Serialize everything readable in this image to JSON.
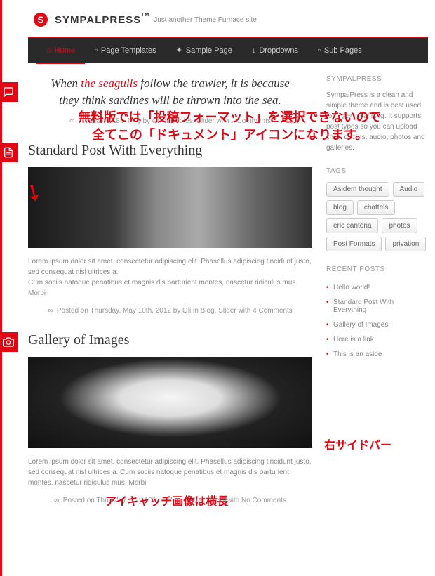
{
  "header": {
    "logo_letter": "S",
    "site_name": "SYMPALPRESS",
    "tm": "TM",
    "tagline": "Just another Theme Furnace site"
  },
  "nav": [
    {
      "label": "Home",
      "icon": "home",
      "active": true
    },
    {
      "label": "Page Templates",
      "icon": "page"
    },
    {
      "label": "Sample Page",
      "icon": "plus"
    },
    {
      "label": "Dropdowns",
      "icon": "down"
    },
    {
      "label": "Sub Pages",
      "icon": "page"
    }
  ],
  "posts": {
    "quote": {
      "text_pre": "When ",
      "text_hl": "the seagulls",
      "text_post": " follow the trawler, it is because they think sardines will be thrown into the sea.",
      "meta": "Posted on 18th May by Oli in Quotes, Slider with 2 Comments"
    },
    "standard": {
      "title": "Standard Post With Everything",
      "excerpt": "Lorem ipsum dolor sit amet, consectetur adipiscing elit. Phasellus adipiscing tincidunt justo, sed consequat nisl ultrices a.\nCum sociis natoque penatibus et magnis dis parturient montes, nascetur ridiculus mus. Morbi",
      "meta": "Posted on Thursday, May 10th, 2012 by Oli in Blog, Slider with 4 Comments"
    },
    "gallery": {
      "title": "Gallery of Images",
      "excerpt": "Lorem ipsum dolor sit amet, consectetur adipiscing elit. Phasellus adipiscing tincidunt justo, sed consequat nisl ultrices a. Cum sociis natoque penatibus et magnis dis parturient montes, nascetur ridiculus mus. Morbi",
      "meta": "Posted on Thursday, May 10th, 2012 by Oli in Photo with No Comments"
    }
  },
  "sidebar": {
    "about_title": "SYMPALPRESS",
    "about_text": "SympalPress is a clean and simple theme and is best used for a personal blog. It supports post types so you can upload links, quotes, audio, photos and galleries.",
    "tags_title": "TAGS",
    "tags": [
      "Asidem thought",
      "Audio",
      "blog",
      "chattels",
      "eric cantona",
      "photos",
      "Post Formats",
      "privation"
    ],
    "recent_title": "RECENT POSTS",
    "recent": [
      "Hello world!",
      "Standard Post With Everything",
      "Gallery of Images",
      "Here is a link",
      "This is an aside"
    ]
  },
  "annotations": {
    "ann1_line1": "無料版では「投稿フォーマット」を選択できないので",
    "ann1_line2": "全てこの「ドキュメント」アイコンになります。",
    "ann2": "アイキャッチ画像は横長",
    "ann3": "右サイドバー"
  }
}
